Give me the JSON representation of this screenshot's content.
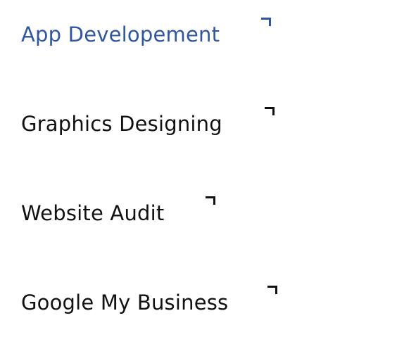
{
  "services": {
    "items": [
      {
        "label": "App Developement",
        "icon": "corner-arrow-icon",
        "active": true
      },
      {
        "label": "Graphics Designing",
        "icon": "corner-arrow-icon",
        "active": false
      },
      {
        "label": "Website Audit",
        "icon": "corner-arrow-icon",
        "active": false
      },
      {
        "label": "Google My Business",
        "icon": "corner-arrow-icon",
        "active": false
      }
    ]
  },
  "colors": {
    "active": "#2f56a1",
    "default": "#111111",
    "background": "#ffffff"
  }
}
